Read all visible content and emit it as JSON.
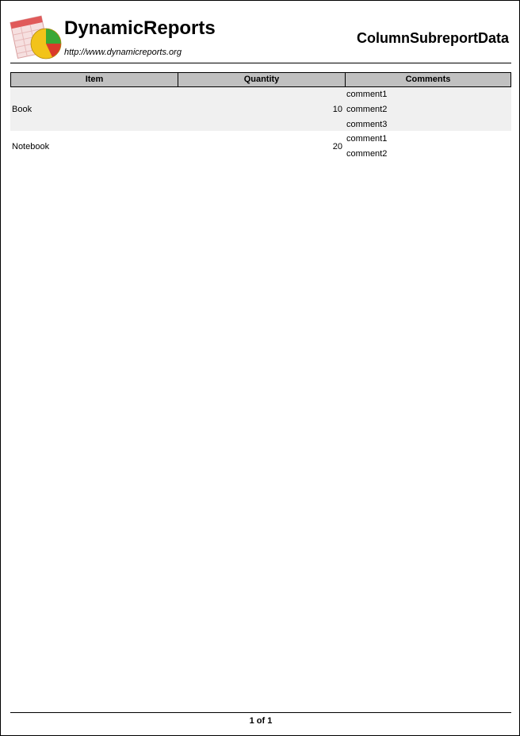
{
  "header": {
    "brand_name": "DynamicReports",
    "brand_url": "http://www.dynamicreports.org",
    "report_title": "ColumnSubreportData",
    "logo_icon": "dynamicreports-logo-icon"
  },
  "table": {
    "columns": [
      "Item",
      "Quantity",
      "Comments"
    ],
    "header_color": "#c0c0c0",
    "alt_row_color": "#f0f0f0",
    "rows": [
      {
        "item": "Book",
        "quantity": "10",
        "comments": [
          "comment1",
          "comment2",
          "comment3"
        ]
      },
      {
        "item": "Notebook",
        "quantity": "20",
        "comments": [
          "comment1",
          "comment2"
        ]
      }
    ]
  },
  "footer": {
    "page_text": "1 of 1"
  }
}
